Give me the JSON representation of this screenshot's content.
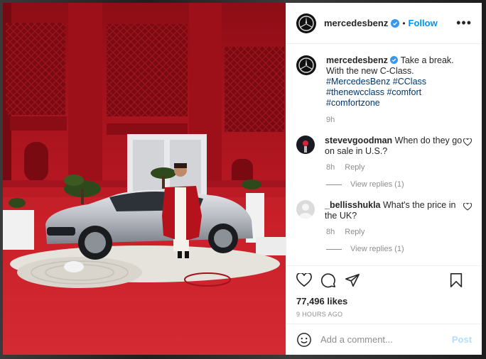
{
  "post": {
    "username": "mercedesbenz",
    "dot": "•",
    "follow_label": "Follow",
    "more_label": "•••",
    "caption_user": "mercedesbenz",
    "caption_text": "Take a break. With the new C-Class.",
    "caption_tags": "#MercedesBenz #CClass #thenewcclass #comfort #comfortzone",
    "caption_age": "9h",
    "likes": "77,496 likes",
    "posted_ago": "9 HOURS AGO"
  },
  "comments": [
    {
      "user": "stevevgoodman",
      "text": "When do they go on sale in U.S.?",
      "age": "8h",
      "reply_label": "Reply",
      "view_replies": "View replies (1)"
    },
    {
      "user": "_bellisshukla",
      "text": "What's the price in the UK?",
      "age": "8h",
      "reply_label": "Reply",
      "view_replies": "View replies (1)"
    }
  ],
  "add_comment": {
    "placeholder": "Add a comment...",
    "post_label": "Post"
  },
  "colors": {
    "accent": "#0095f6",
    "link": "#00376b",
    "photo_red": "#b3121c"
  },
  "icons": [
    "mercedes-logo-icon",
    "verified-badge-icon",
    "heart-icon",
    "comment-icon",
    "share-icon",
    "bookmark-icon",
    "emoji-icon"
  ]
}
